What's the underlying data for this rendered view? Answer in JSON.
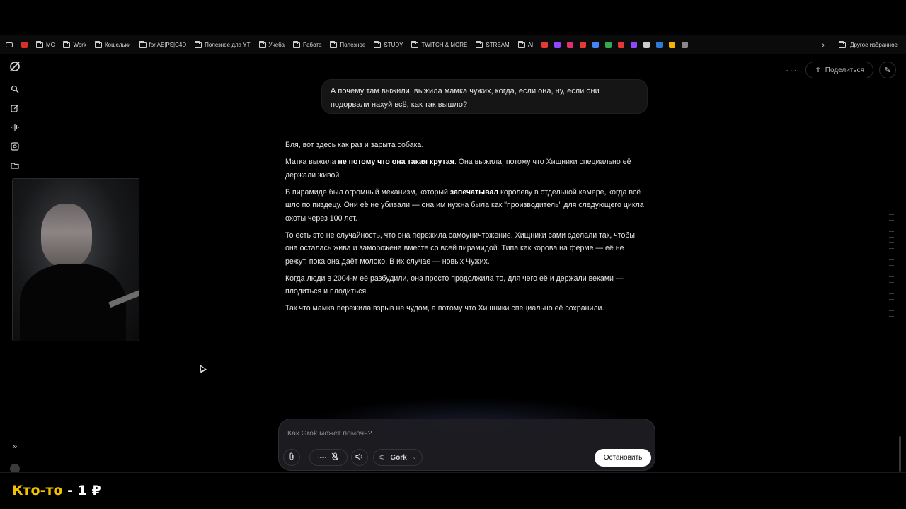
{
  "bookmarks": {
    "items": [
      {
        "label": "MC",
        "type": "folder"
      },
      {
        "label": "Work",
        "type": "folder"
      },
      {
        "label": "Кошельки",
        "type": "folder"
      },
      {
        "label": "for AE|PS|C4D",
        "type": "folder"
      },
      {
        "label": "Полезное дла YT",
        "type": "folder"
      },
      {
        "label": "Учеба",
        "type": "folder"
      },
      {
        "label": "Работа",
        "type": "folder"
      },
      {
        "label": "Полезное",
        "type": "folder"
      },
      {
        "label": "STUDY",
        "type": "folder"
      },
      {
        "label": "TWITCH & MORE",
        "type": "folder"
      },
      {
        "label": "STREAM",
        "type": "folder"
      },
      {
        "label": "AI",
        "type": "folder"
      }
    ],
    "favicon_colors": [
      "#e53935",
      "#9147ff",
      "#e1306c",
      "#e53935",
      "#4285f4",
      "#34a853",
      "#e53935",
      "#9147ff",
      "#cccccc",
      "#2e7bd6",
      "#f4b400",
      "#888888"
    ],
    "other_bookmarks": "Другое избранное"
  },
  "header": {
    "share_label": "Поделиться"
  },
  "user_message": "А почему там выжили, выжила мамка чужих, когда, если она, ну, если они подорвали нахуй всё, как так вышло?",
  "answer": {
    "p1": "Бля, вот здесь как раз и зарыта собака.",
    "p2_a": "Матка выжила ",
    "p2_b": "не потому что она такая крутая",
    "p2_c": ". Она выжила, потому что Хищники специально её держали живой.",
    "p3_a": "В пирамиде был огромный механизм, который ",
    "p3_b": "запечатывал",
    "p3_c": " королеву в отдельной камере, когда всё шло по пиздецу. Они её не убивали — она им нужна была как \"производитель\" для следующего цикла охоты через 100 лет.",
    "p4": "То есть это не случайность, что она пережила самоуничтожение. Хищники сами сделали так, чтобы она осталась жива и заморожена вместе со всей пирамидой. Типа как корова на ферме — её не режут, пока она даёт молоко. В их случае — новых Чужих.",
    "p5": "Когда люди в 2004-м её разбудили, она просто продолжила то, для чего её и держали веками — плодиться и плодиться.",
    "p6": "Так что мамка пережила взрыв не чудом, а потому что Хищники специально её сохранили."
  },
  "composer": {
    "placeholder": "Как Grok может помочь?",
    "model_label": "Gork",
    "stop_label": "Остановить"
  },
  "donation": {
    "name": "Кто-то",
    "separator": " - ",
    "amount": "1 ₽"
  }
}
